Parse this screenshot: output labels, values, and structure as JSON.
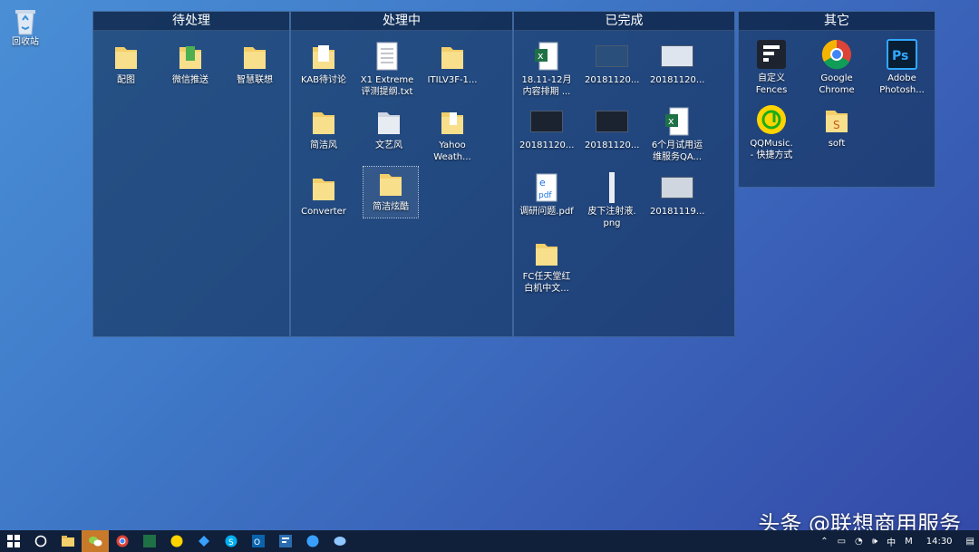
{
  "desktop": {
    "recycle_bin": "回收站"
  },
  "fences": [
    {
      "title": "待处理",
      "items": [
        "配图",
        "微信推送",
        "智慧联想"
      ]
    },
    {
      "title": "处理中",
      "items": [
        "KAB待讨论",
        "X1 Extreme\n评测提纲.txt",
        "ITILV3F-1...",
        "简洁风",
        "文艺风",
        "Yahoo\nWeath...",
        "Converter",
        "简洁炫酷"
      ]
    },
    {
      "title": "已完成",
      "items": [
        "18.11-12月\n内容排期 ...",
        "20181120...",
        "20181120...",
        "20181120...",
        "20181120...",
        "6个月试用运\n维服务QA...",
        "调研问题.pdf",
        "皮下注射液.\npng",
        "20181119...",
        "FC任天堂红\n白机中文..."
      ]
    },
    {
      "title": "其它",
      "items": [
        "自定义\nFences",
        "Google\nChrome",
        "Adobe\nPhotosh...",
        "QQMusic.\n- 快捷方式",
        "soft"
      ]
    }
  ],
  "taskbar": {
    "tray_ime": "中",
    "tray_m": "M",
    "time": "14:30"
  },
  "watermark": "头条 @联想商用服务"
}
